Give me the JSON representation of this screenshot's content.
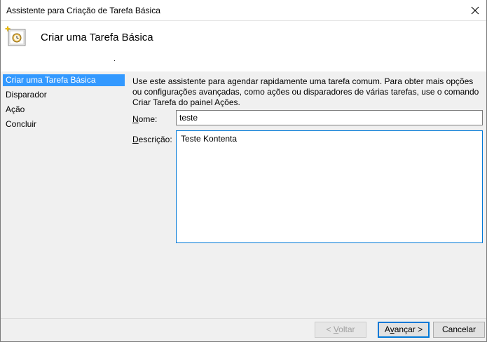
{
  "window": {
    "title": "Assistente para Criação de Tarefa Básica",
    "close_icon": "close-icon"
  },
  "header": {
    "heading": "Criar uma Tarefa Básica",
    "icon": "task-clock-icon",
    "dot": "."
  },
  "sidebar": {
    "items": [
      {
        "label": "Criar uma Tarefa Básica",
        "active": true
      },
      {
        "label": "Disparador",
        "active": false
      },
      {
        "label": "Ação",
        "active": false
      },
      {
        "label": "Concluir",
        "active": false
      }
    ]
  },
  "main": {
    "intro": "Use este assistente para agendar rapidamente uma tarefa comum. Para obter mais opções ou configurações avançadas, como ações ou disparadores de várias tarefas, use o comando Criar Tarefa do painel Ações.",
    "name_label_key": "N",
    "name_label_rest": "ome:",
    "name_value": "teste",
    "desc_label_key": "D",
    "desc_label_rest": "escrição:",
    "desc_value": "Teste Kontenta"
  },
  "footer": {
    "back_pre": "< ",
    "back_key": "V",
    "back_rest": "oltar",
    "next_pre": "A",
    "next_key": "v",
    "next_rest": "ançar >",
    "cancel_label": "Cancelar"
  },
  "colors": {
    "selection": "#3399ff",
    "focus_border": "#0078d7",
    "window_bg": "#f0f0f0"
  }
}
